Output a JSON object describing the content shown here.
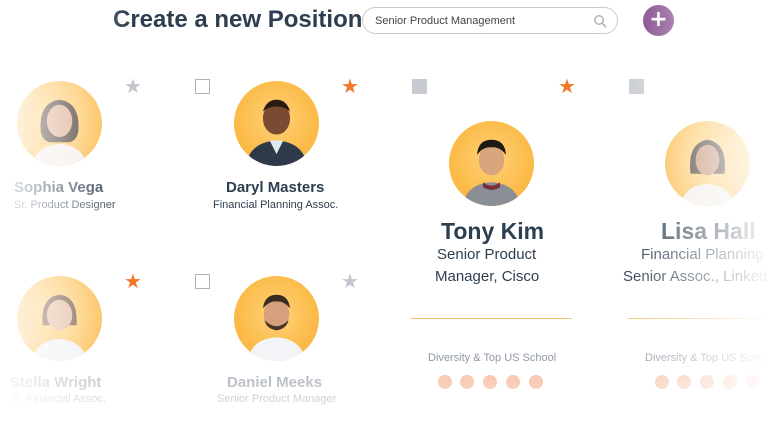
{
  "header": {
    "title": "Create a new Position",
    "search_value": "Senior Product Management",
    "add_label": "+"
  },
  "candidates": [
    {
      "name": "Sophia Vega",
      "role": "Sr. Product Designer",
      "starred": false
    },
    {
      "name": "Daryl Masters",
      "role": "Financial Planning Assoc.",
      "starred": true
    },
    {
      "name": "Tony Kim",
      "role_line1": "Senior Product",
      "role_line2": "Manager, Cisco",
      "starred": true,
      "tag": "Diversity & Top US School"
    },
    {
      "name": "Lisa Hall",
      "role_line1": "Financial Planning",
      "role_line2": "Senior Assoc., LinkedIn",
      "tag": "Diversity & Top US School"
    },
    {
      "name": "Stella Wright",
      "role": "Sr. Financial Assoc.",
      "starred": true
    },
    {
      "name": "Daniel Meeks",
      "role": "Senior Product Manager",
      "starred": false
    }
  ],
  "colors": {
    "accent_purple": "#7a3b83",
    "star_orange": "#f07a2a",
    "avatar_yellow": "#fbb843",
    "heading": "#2d3e50"
  }
}
